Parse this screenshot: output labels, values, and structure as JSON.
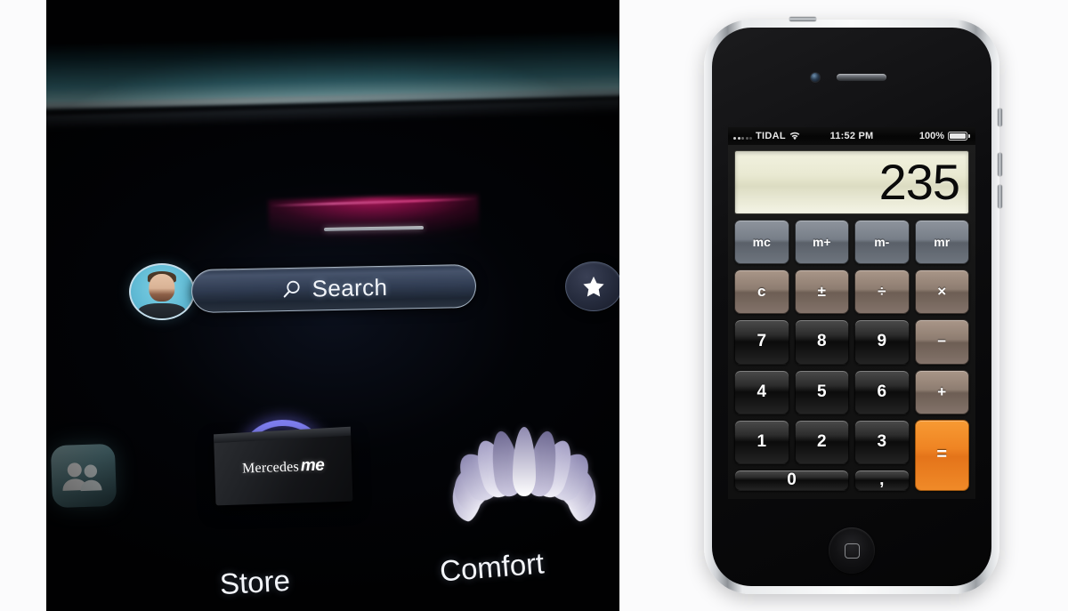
{
  "layout": {
    "background_color": "#fbfbfc"
  },
  "car_display": {
    "name": "MBUX infotainment home screen",
    "background_color": "#020306",
    "ambient_light_top_color": "#b0f4fc",
    "ambient_light_accent_color": "#ff3c8c",
    "avatar": {
      "label": "user-profile-avatar"
    },
    "search": {
      "label": "Search",
      "icon": "magnifier-icon"
    },
    "favorites": {
      "icon": "star-icon"
    },
    "tiles": [
      {
        "id": "contacts",
        "label": "",
        "icon": "contacts-people-icon",
        "color": "#74a8b0"
      },
      {
        "id": "store",
        "label": "Store",
        "icon": "mercedes-me-shopping-bag-icon",
        "brand_primary": "Mercedes",
        "brand_secondary": "me",
        "handle_color": "#7e7ef0"
      },
      {
        "id": "comfort",
        "label": "Comfort",
        "icon": "lotus-flower-icon",
        "petal_color": "#a9a3c6"
      }
    ]
  },
  "phone": {
    "device": "iPhone 4",
    "status_bar": {
      "carrier": "TIDAL",
      "signal_icon": "signal-dots-icon",
      "wifi_icon": "wifi-icon",
      "time": "11:52 PM",
      "battery_percent": "100%",
      "battery_icon": "battery-full-icon"
    },
    "calculator": {
      "display_value": "235",
      "display_color": "#e9e9d2",
      "equals_color": "#ef8423",
      "memory_keys": [
        {
          "label": "mc",
          "name": "memory-clear-key"
        },
        {
          "label": "m+",
          "name": "memory-add-key"
        },
        {
          "label": "m-",
          "name": "memory-subtract-key"
        },
        {
          "label": "mr",
          "name": "memory-recall-key"
        }
      ],
      "operator_keys": [
        {
          "label": "c",
          "name": "clear-key"
        },
        {
          "label": "±",
          "name": "plus-minus-key"
        },
        {
          "label": "÷",
          "name": "divide-key"
        },
        {
          "label": "×",
          "name": "multiply-key"
        }
      ],
      "row3": [
        {
          "label": "7",
          "name": "digit-7-key"
        },
        {
          "label": "8",
          "name": "digit-8-key"
        },
        {
          "label": "9",
          "name": "digit-9-key"
        },
        {
          "label": "−",
          "name": "minus-key"
        }
      ],
      "row4": [
        {
          "label": "4",
          "name": "digit-4-key"
        },
        {
          "label": "5",
          "name": "digit-5-key"
        },
        {
          "label": "6",
          "name": "digit-6-key"
        },
        {
          "label": "+",
          "name": "plus-key"
        }
      ],
      "row5": [
        {
          "label": "1",
          "name": "digit-1-key"
        },
        {
          "label": "2",
          "name": "digit-2-key"
        },
        {
          "label": "3",
          "name": "digit-3-key"
        }
      ],
      "row6": [
        {
          "label": "0",
          "name": "digit-0-key"
        },
        {
          "label": ",",
          "name": "decimal-separator-key"
        }
      ],
      "equals": {
        "label": "=",
        "name": "equals-key"
      }
    },
    "hardware": {
      "camera": "front-camera",
      "earpiece": "earpiece-speaker",
      "home_button": "home-button"
    }
  }
}
